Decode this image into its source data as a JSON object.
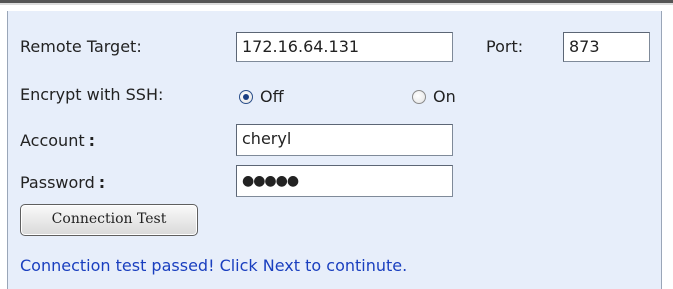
{
  "form": {
    "remote_target_label": "Remote Target:",
    "remote_target_value": "172.16.64.131",
    "port_label": "Port:",
    "port_value": "873",
    "encrypt_label": "Encrypt with SSH:",
    "encrypt_options": [
      "Off",
      "On"
    ],
    "encrypt_selected": "Off",
    "account_label": "Account",
    "account_value": "cheryl",
    "password_label": "Password",
    "password_value": "●●●●●",
    "colon_glyph": ":"
  },
  "actions": {
    "connection_test_label": "Connection Test"
  },
  "status": {
    "message": "Connection test passed! Click Next to continute.",
    "color": "#1a3fbf"
  },
  "colors": {
    "panel_bg": "#e7eefa"
  }
}
